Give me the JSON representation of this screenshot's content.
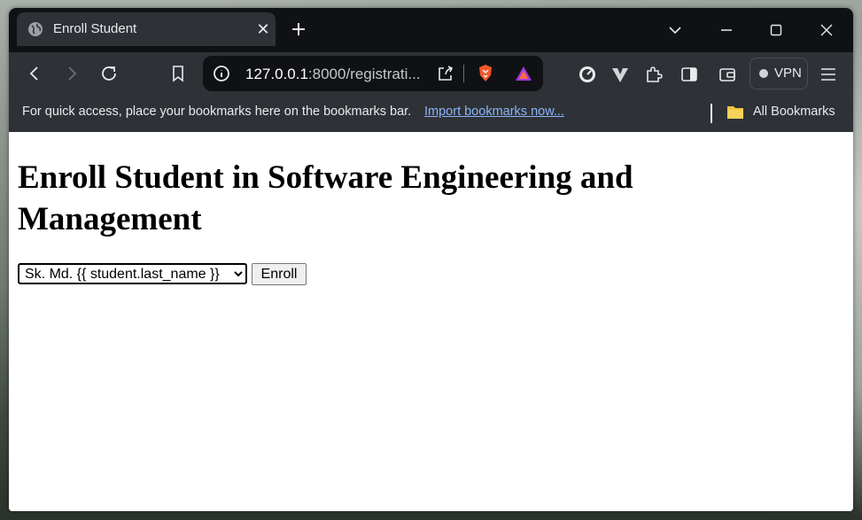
{
  "browser": {
    "tab_title": "Enroll Student",
    "url_host": "127.0.0.1",
    "url_rest": ":8000/registrati...",
    "vpn_label": "VPN"
  },
  "bookmarks_bar": {
    "message": "For quick access, place your bookmarks here on the bookmarks bar.",
    "import_link": "Import bookmarks now...",
    "all_bookmarks": "All Bookmarks"
  },
  "page": {
    "heading": "Enroll Student in Software Engineering and Management",
    "student_select_value": "Sk. Md. {{ student.last_name }}",
    "enroll_button": "Enroll"
  }
}
